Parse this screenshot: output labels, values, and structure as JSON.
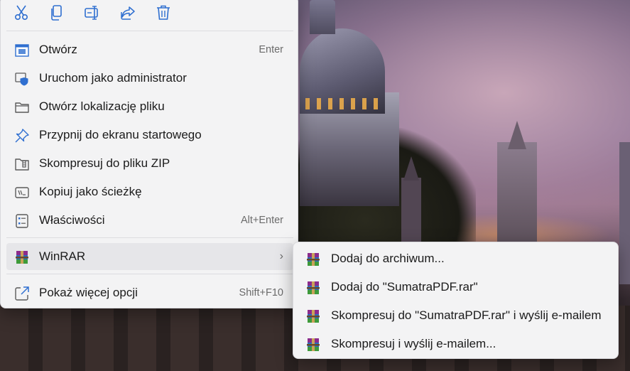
{
  "toolbar": {
    "buttons": [
      {
        "name": "cut",
        "icon": "scissors-icon"
      },
      {
        "name": "copy",
        "icon": "copy-icon"
      },
      {
        "name": "rename",
        "icon": "rename-icon"
      },
      {
        "name": "share",
        "icon": "share-icon"
      },
      {
        "name": "delete",
        "icon": "trash-icon"
      }
    ]
  },
  "menu": {
    "items": [
      {
        "label": "Otwórz",
        "shortcut": "Enter",
        "icon": "open-app-icon"
      },
      {
        "label": "Uruchom jako administrator",
        "shortcut": "",
        "icon": "shield-icon"
      },
      {
        "label": "Otwórz lokalizację pliku",
        "shortcut": "",
        "icon": "folder-icon"
      },
      {
        "label": "Przypnij do ekranu startowego",
        "shortcut": "",
        "icon": "pin-icon"
      },
      {
        "label": "Skompresuj do pliku ZIP",
        "shortcut": "",
        "icon": "zip-icon"
      },
      {
        "label": "Kopiuj jako ścieżkę",
        "shortcut": "",
        "icon": "copy-path-icon"
      },
      {
        "label": "Właściwości",
        "shortcut": "Alt+Enter",
        "icon": "properties-icon"
      }
    ],
    "winrar": {
      "label": "WinRAR",
      "icon": "winrar-icon",
      "chevron": "›"
    },
    "more": {
      "label": "Pokaż więcej opcji",
      "shortcut": "Shift+F10",
      "icon": "more-options-icon"
    }
  },
  "submenu": {
    "items": [
      {
        "label": "Dodaj do archiwum...",
        "icon": "winrar-icon"
      },
      {
        "label": "Dodaj do \"SumatraPDF.rar\"",
        "icon": "winrar-icon"
      },
      {
        "label": "Skompresuj do \"SumatraPDF.rar\" i wyślij e-mailem",
        "icon": "winrar-icon"
      },
      {
        "label": "Skompresuj i wyślij e-mailem...",
        "icon": "winrar-icon"
      }
    ]
  },
  "colors": {
    "menu_bg": "#f3f3f4",
    "hover_bg": "#e6e6e9",
    "icon_blue": "#2f6fd0",
    "text": "#1b1b1b",
    "shortcut": "#6b6b6b"
  }
}
